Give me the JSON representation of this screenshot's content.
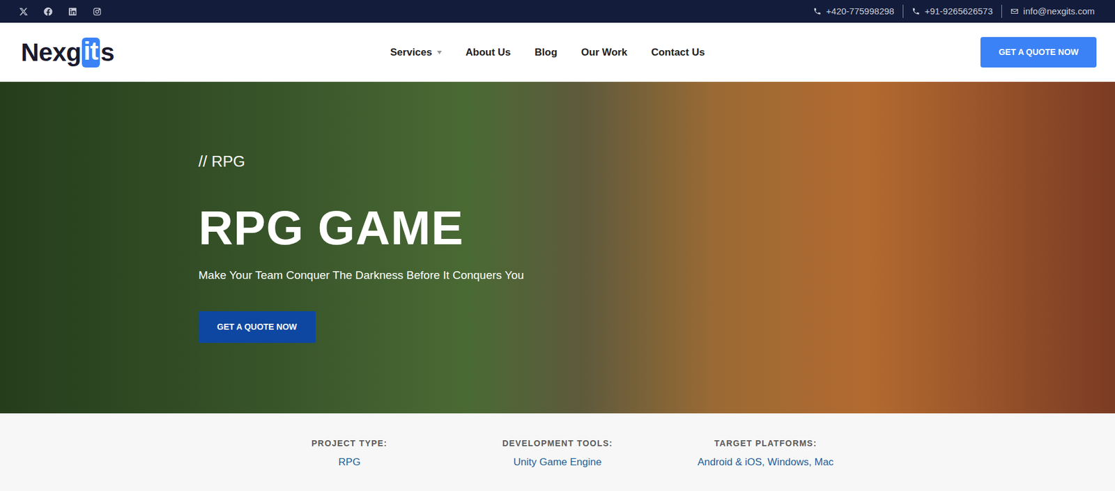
{
  "top_bar": {
    "contacts": [
      {
        "text": "+420-775998298",
        "kind": "phone"
      },
      {
        "text": "+91-9265626573",
        "kind": "phone"
      },
      {
        "text": "info@nexgits.com",
        "kind": "email"
      }
    ]
  },
  "logo": {
    "before": "Nexg",
    "highlight": "it",
    "after": "s"
  },
  "nav": {
    "items": [
      {
        "label": "Services",
        "dropdown": true
      },
      {
        "label": "About Us",
        "dropdown": false
      },
      {
        "label": "Blog",
        "dropdown": false
      },
      {
        "label": "Our Work",
        "dropdown": false
      },
      {
        "label": "Contact Us",
        "dropdown": false
      }
    ],
    "button": "GET A QUOTE NOW"
  },
  "hero": {
    "eyebrow": "// RPG",
    "title": "RPG GAME",
    "subtitle": "Make Your Team Conquer The Darkness Before It Conquers You",
    "button": "GET A QUOTE NOW"
  },
  "details": [
    {
      "label": "PROJECT TYPE:",
      "value": "RPG"
    },
    {
      "label": "DEVELOPMENT TOOLS:",
      "value": "Unity Game Engine"
    },
    {
      "label": "TARGET PLATFORMS:",
      "value": "Android & iOS, Windows, Mac"
    }
  ]
}
